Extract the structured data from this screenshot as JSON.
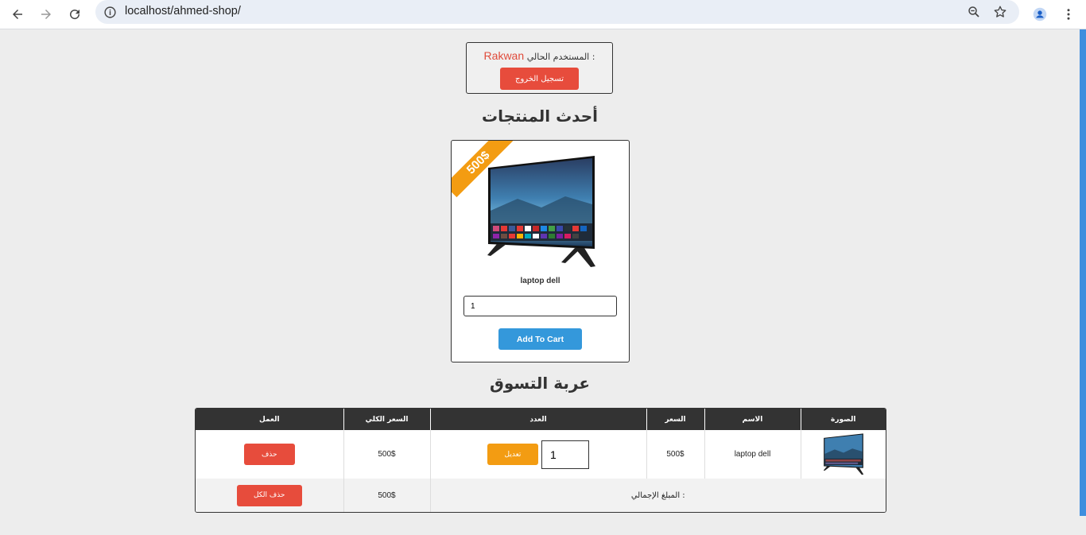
{
  "browser": {
    "url": "localhost/ahmed-shop/",
    "icons": [
      "back-arrow-icon",
      "forward-arrow-icon",
      "reload-icon",
      "site-info-icon",
      "zoom-icon",
      "bookmark-star-icon",
      "profile-icon",
      "kebab-menu-icon"
    ]
  },
  "user": {
    "label": ": المستخدم الحالي",
    "username": "Rakwan",
    "logout_label": "تسجيل الخروج"
  },
  "products_section": {
    "title": "أحدث المنتجات"
  },
  "product": {
    "price_badge": "500$",
    "name": "laptop dell",
    "quantity_value": "1",
    "add_to_cart_label": "Add To Cart"
  },
  "cart_section": {
    "title": "عربة التسوق",
    "headers": {
      "image": "الصورة",
      "name": "الاسم",
      "price": "السعر",
      "quantity": "العدد",
      "total_price": "السعر الكلي",
      "action": "العمل"
    },
    "items": [
      {
        "name": "laptop dell",
        "price": "500$",
        "quantity": "1",
        "edit_label": "تعديل",
        "total": "500$",
        "delete_label": "حذف"
      }
    ],
    "grand_total_label": ": المبلغ الإجمالي",
    "grand_total_value": "500$",
    "delete_all_label": "حذف الكل"
  },
  "colors": {
    "danger": "#e74c3c",
    "warning": "#f39c12",
    "primary": "#3498db",
    "header_dark": "#333333"
  }
}
